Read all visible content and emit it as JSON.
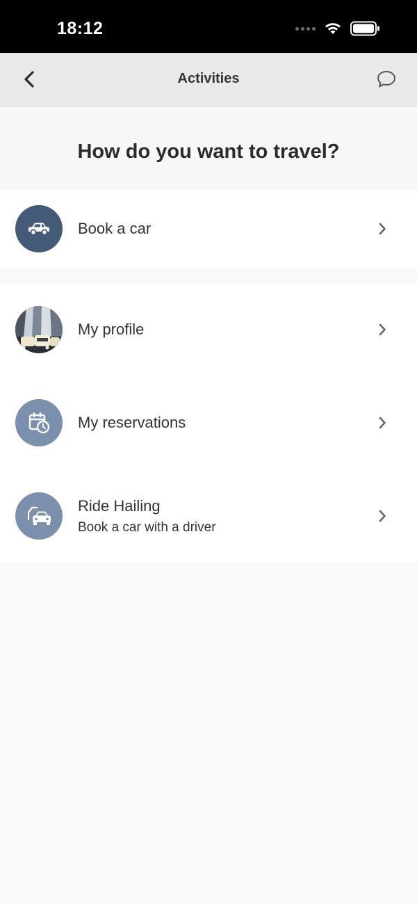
{
  "status_bar": {
    "time": "18:12"
  },
  "nav": {
    "title": "Activities"
  },
  "heading": "How do you want to travel?",
  "items": [
    {
      "label": "Book a car",
      "icon": "car-icon"
    },
    {
      "label": "My profile",
      "icon": "profile-photo-icon"
    },
    {
      "label": "My reservations",
      "icon": "calendar-clock-icon"
    },
    {
      "label": "Ride Hailing",
      "sublabel": "Book a car with a driver",
      "icon": "ride-hailing-icon"
    }
  ],
  "colors": {
    "icon_dark": "#435a78",
    "icon_light": "#7b90ad",
    "nav_bg": "#e9e9e9"
  }
}
